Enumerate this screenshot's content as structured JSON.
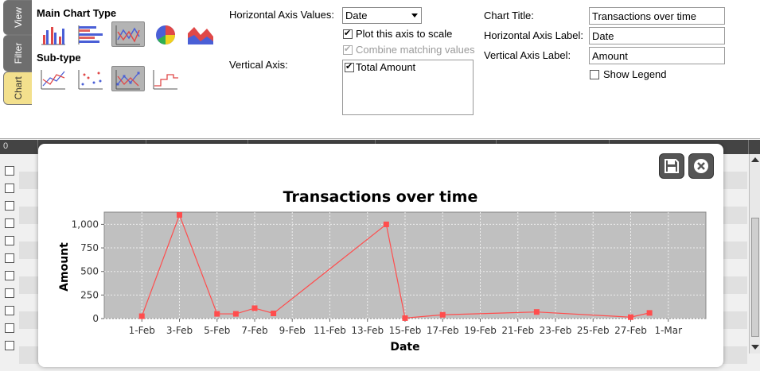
{
  "tabs": {
    "view": "View",
    "filter": "Filter",
    "chart": "Chart"
  },
  "chart_types": {
    "main_title": "Main Chart Type",
    "sub_title": "Sub-type",
    "main": [
      "bar-chart-icon",
      "horizontal-bar-chart-icon",
      "line-chart-icon",
      "pie-chart-icon",
      "area-chart-icon"
    ],
    "main_selected": "line-chart-icon",
    "sub": [
      "line-icon",
      "dots-icon",
      "line-with-markers-icon",
      "step-line-icon"
    ],
    "sub_selected": "line-with-markers-icon"
  },
  "axis_settings": {
    "horizontal_label": "Horizontal Axis Values:",
    "horizontal_value": "Date",
    "plot_scale_label": "Plot this axis to scale",
    "plot_scale_checked": true,
    "combine_label": "Combine matching values",
    "combine_checked": true,
    "vertical_label": "Vertical Axis:",
    "vertical_items": [
      {
        "label": "Total Amount",
        "checked": true
      }
    ]
  },
  "titles": {
    "chart_title_label": "Chart Title:",
    "chart_title_value": "Transactions over time",
    "h_axis_label": "Horizontal Axis Label:",
    "h_axis_value": "Date",
    "v_axis_label": "Vertical Axis Label:",
    "v_axis_value": "Amount",
    "show_legend_label": "Show Legend",
    "show_legend_checked": false
  },
  "table": {
    "first_header": "0"
  },
  "colors": {
    "series": "#ff4d4d",
    "plot_bg": "#c0c0c0",
    "tab_active": "#f3e08d"
  },
  "chart_data": {
    "type": "line",
    "title": "Transactions over time",
    "xlabel": "Date",
    "ylabel": "Amount",
    "xlim": [
      "2024-01-30",
      "2024-03-02"
    ],
    "ylim": [
      0,
      1130
    ],
    "grid": true,
    "legend": "none",
    "x_ticks": [
      "1-Feb",
      "3-Feb",
      "5-Feb",
      "7-Feb",
      "9-Feb",
      "11-Feb",
      "13-Feb",
      "15-Feb",
      "17-Feb",
      "19-Feb",
      "21-Feb",
      "23-Feb",
      "25-Feb",
      "27-Feb",
      "1-Mar"
    ],
    "y_ticks": [
      "0",
      "250",
      "500",
      "750",
      "1,000"
    ],
    "series": [
      {
        "x": [
          "2024-02-01",
          "2024-02-03",
          "2024-02-05",
          "2024-02-06",
          "2024-02-07",
          "2024-02-08",
          "2024-02-14",
          "2024-02-15",
          "2024-02-17",
          "2024-02-22",
          "2024-02-27",
          "2024-02-28"
        ],
        "values": [
          25,
          1100,
          50,
          50,
          110,
          55,
          1000,
          5,
          40,
          70,
          15,
          60
        ]
      }
    ]
  }
}
